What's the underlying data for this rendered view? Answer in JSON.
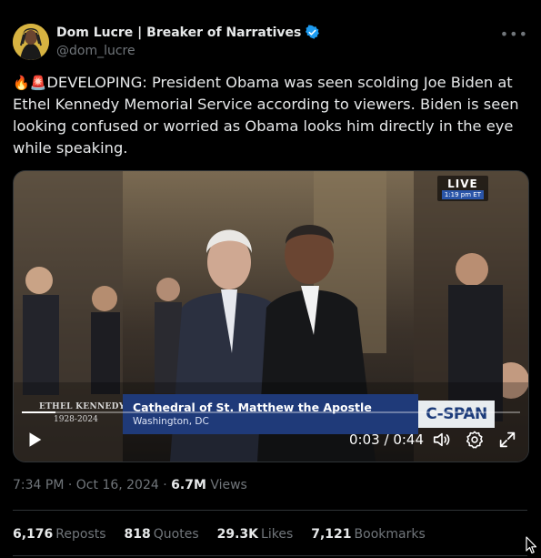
{
  "author": {
    "name": "Dom Lucre | Breaker of Narratives",
    "handle": "@dom_lucre",
    "verified_icon": "verified-badge-icon",
    "badge_color": "#1d9bf0"
  },
  "more_icon": "more-options-icon",
  "tweet": {
    "emoji_fire": "🔥",
    "emoji_siren": "🚨",
    "text": "DEVELOPING: President Obama was seen scolding Joe Biden at Ethel Kennedy Memorial Service according to viewers. Biden is seen looking confused or worried as Obama looks him directly in the eye while speaking."
  },
  "video": {
    "live_label": "LIVE",
    "live_time": "1:19 pm ET",
    "chyron_name": "ETHEL KENNEDY",
    "chyron_years": "1928-2024",
    "chyron_title": "Cathedral of St. Matthew the Apostle",
    "chyron_subtitle": "Washington, DC",
    "network_logo": "C-SPAN",
    "time_current": "0:03",
    "time_separator": "/",
    "time_total": "0:44",
    "progress_fraction": 0.068,
    "icons": [
      "play-icon",
      "volume-icon",
      "settings-gear-icon",
      "fullscreen-icon"
    ]
  },
  "meta": {
    "time": "7:34 PM",
    "date": "Oct 16, 2024",
    "separator": "·",
    "views_count": "6.7M",
    "views_label": "Views"
  },
  "stats": {
    "reposts_count": "6,176",
    "reposts_label": "Reposts",
    "quotes_count": "818",
    "quotes_label": "Quotes",
    "likes_count": "29.3K",
    "likes_label": "Likes",
    "bookmarks_count": "7,121",
    "bookmarks_label": "Bookmarks"
  },
  "colors": {
    "background": "#000000",
    "text_primary": "#e7e9ea",
    "text_secondary": "#71767b",
    "chyron_blue": "#1f3a79"
  }
}
